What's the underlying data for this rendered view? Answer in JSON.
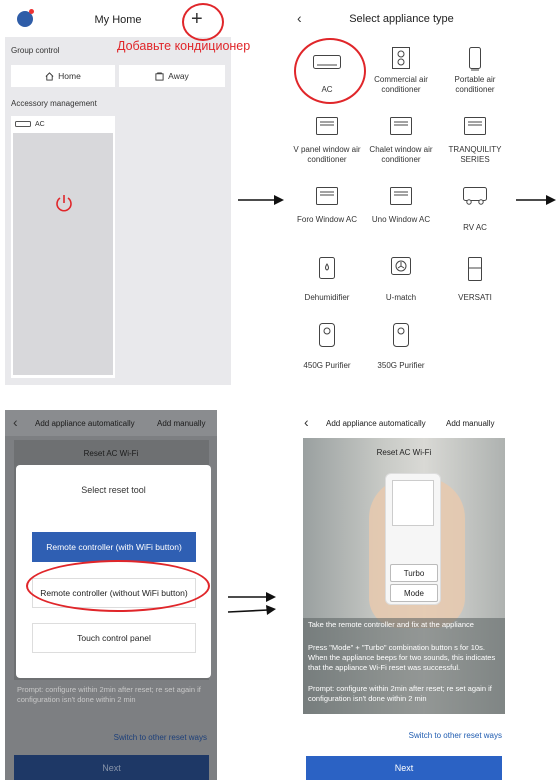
{
  "annotation": {
    "text": "Добавьте кондиционер"
  },
  "panel1": {
    "title": "My Home",
    "plus_icon": "+",
    "group_label": "Group control",
    "home_label": "Home",
    "away_label": "Away",
    "accessory_label": "Accessory management",
    "device_name": "AC"
  },
  "panel2": {
    "title": "Select appliance type",
    "appliances": [
      {
        "label": "AC",
        "icon": "ac-icon"
      },
      {
        "label": "Commercial air conditioner",
        "icon": "commercial-ac-icon"
      },
      {
        "label": "Portable air conditioner",
        "icon": "portable-ac-icon"
      },
      {
        "label": "V panel window air conditioner",
        "icon": "window-ac-icon"
      },
      {
        "label": "Chalet window air conditioner",
        "icon": "window-ac-icon"
      },
      {
        "label": "TRANQUILITY SERIES",
        "icon": "window-ac-icon"
      },
      {
        "label": "Foro Window AC",
        "icon": "window-ac-icon"
      },
      {
        "label": "Uno Window AC",
        "icon": "window-ac-icon"
      },
      {
        "label": "RV AC",
        "icon": "rv-ac-icon"
      },
      {
        "label": "Dehumidifier",
        "icon": "dehumidifier-icon"
      },
      {
        "label": "U-match",
        "icon": "fan-icon"
      },
      {
        "label": "VERSATI",
        "icon": "versati-icon"
      },
      {
        "label": "450G Purifier",
        "icon": "purifier-icon"
      },
      {
        "label": "350G Purifier",
        "icon": "purifier-icon"
      }
    ]
  },
  "panel3": {
    "tab_auto": "Add appliance automatically",
    "tab_manual": "Add manually",
    "bg_title": "Reset AC Wi-Fi",
    "modal_title": "Select reset tool",
    "btn_with_wifi": "Remote controller (with WiFi button)",
    "btn_without_wifi": "Remote controller (without WiFi button)",
    "btn_touch": "Touch control panel",
    "prompt": "Prompt: configure within 2min after reset; re set again if configuration isn't done within 2 min",
    "switch_link": "Switch to other reset ways",
    "next": "Next"
  },
  "panel4": {
    "tab_auto": "Add appliance automatically",
    "tab_manual": "Add manually",
    "title": "Reset AC Wi-Fi",
    "turbo": "Turbo",
    "mode": "Mode",
    "instruction1": "Take the remote controller and fix at the appliance",
    "instruction2": "Press \"Mode\" + \"Turbo\" combination button s for 10s. When the appliance beeps for two sounds, this indicates that the appliance Wi-Fi reset was successful.",
    "prompt": "Prompt: configure within 2min after reset; re set again if configuration isn't done within 2 min",
    "switch_link": "Switch to other reset ways",
    "next": "Next"
  },
  "colors": {
    "annotation_red": "#e0262a",
    "primary_blue": "#2b62c4"
  }
}
